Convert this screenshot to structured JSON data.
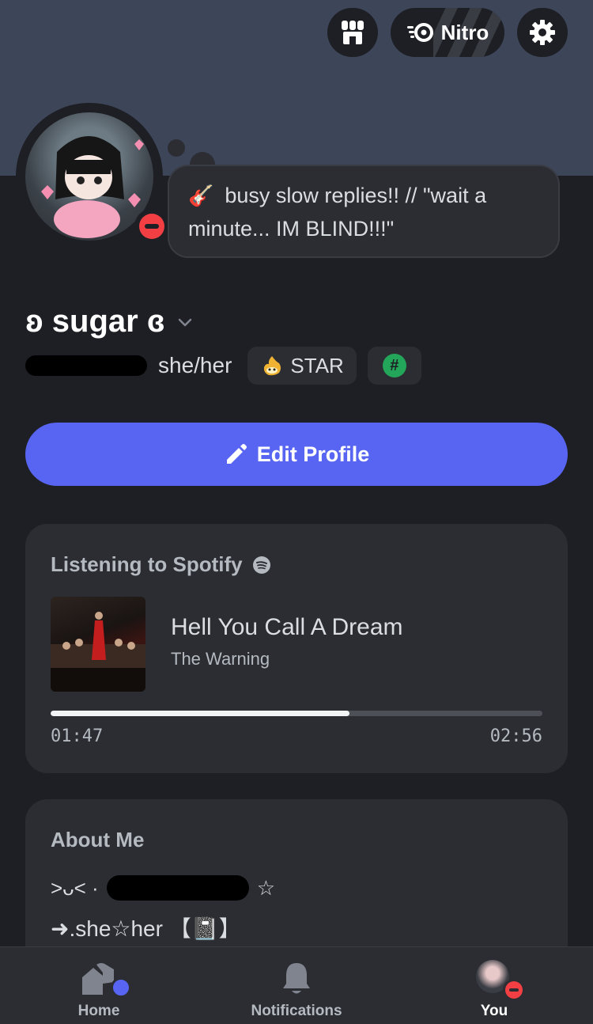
{
  "header": {
    "nitro_label": "Nitro"
  },
  "profile": {
    "status_emoji": "🎸",
    "status_text": "busy slow replies!! // \"wait a minute... IM BLIND!!!\"",
    "display_name": "ʚ sugar ɞ",
    "pronouns": "she/her",
    "badges": [
      {
        "label": "STAR",
        "icon": "flame-star-icon"
      },
      {
        "label": "#",
        "icon": "hash-icon"
      }
    ],
    "status": "do-not-disturb"
  },
  "actions": {
    "edit_profile_label": "Edit Profile"
  },
  "spotify": {
    "title": "Listening to Spotify",
    "track": "Hell You Call A Dream",
    "artist": "The Warning",
    "elapsed": "01:47",
    "duration": "02:56",
    "progress_fraction": 0.608
  },
  "about": {
    "title": "About Me",
    "line1_prefix": "˃ᴗ˂ ·",
    "line1_suffix": "☆",
    "line2": "➜.she☆her 【📓】"
  },
  "tabbar": {
    "tabs": [
      {
        "label": "Home"
      },
      {
        "label": "Notifications"
      },
      {
        "label": "You"
      }
    ]
  },
  "colors": {
    "accent": "#5865f2",
    "dnd": "#f23f43",
    "banner": "#3d4559",
    "background": "#1e1f24",
    "card": "#2b2d33"
  }
}
